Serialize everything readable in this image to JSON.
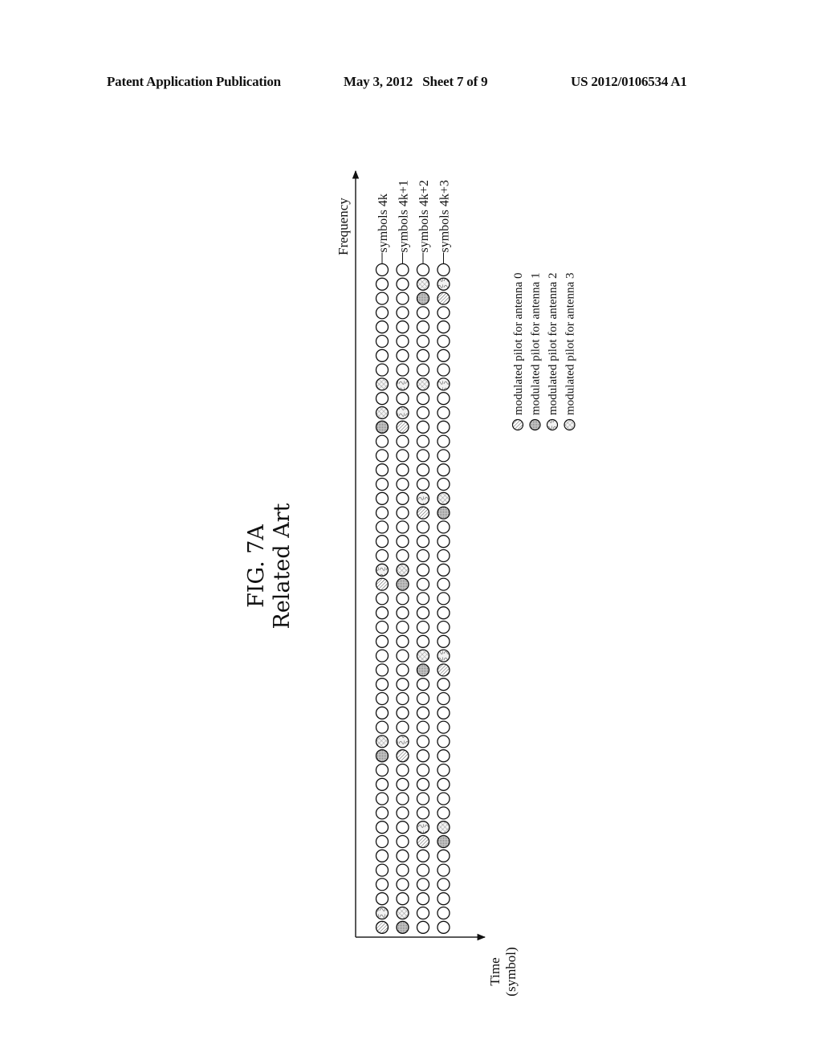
{
  "header": {
    "left": "Patent Application Publication",
    "middle": "May 3, 2012   Sheet 7 of 9",
    "right": "US 2012/0106534 A1"
  },
  "figure": {
    "title": "FIG. 7A",
    "subtitle": "Related Art"
  },
  "diagram": {
    "axis_frequency_label": "Frequency",
    "axis_time_label": "Time",
    "axis_time_sublabel": "(symbol)",
    "subcarriers_per_row": 47,
    "rows": [
      {
        "label": "symbols 4k",
        "pilots": [
          {
            "index": 8,
            "antenna": 3
          },
          {
            "index": 10,
            "antenna": 3
          },
          {
            "index": 11,
            "antenna": 1
          },
          {
            "index": 21,
            "antenna": 2
          },
          {
            "index": 22,
            "antenna": 0
          },
          {
            "index": 33,
            "antenna": 3
          },
          {
            "index": 34,
            "antenna": 1
          },
          {
            "index": 45,
            "antenna": 2
          },
          {
            "index": 46,
            "antenna": 0
          }
        ]
      },
      {
        "label": "symbols 4k+1",
        "pilots": [
          {
            "index": 8,
            "antenna": 2
          },
          {
            "index": 10,
            "antenna": 2
          },
          {
            "index": 11,
            "antenna": 0
          },
          {
            "index": 21,
            "antenna": 3
          },
          {
            "index": 22,
            "antenna": 1
          },
          {
            "index": 33,
            "antenna": 2
          },
          {
            "index": 34,
            "antenna": 0
          },
          {
            "index": 45,
            "antenna": 3
          },
          {
            "index": 46,
            "antenna": 1
          }
        ]
      },
      {
        "label": "symbols 4k+2",
        "pilots": [
          {
            "index": 1,
            "antenna": 3
          },
          {
            "index": 2,
            "antenna": 1
          },
          {
            "index": 8,
            "antenna": 3
          },
          {
            "index": 16,
            "antenna": 2
          },
          {
            "index": 17,
            "antenna": 0
          },
          {
            "index": 27,
            "antenna": 3
          },
          {
            "index": 28,
            "antenna": 1
          },
          {
            "index": 39,
            "antenna": 2
          },
          {
            "index": 40,
            "antenna": 0
          }
        ]
      },
      {
        "label": "symbols 4k+3",
        "pilots": [
          {
            "index": 1,
            "antenna": 2
          },
          {
            "index": 2,
            "antenna": 0
          },
          {
            "index": 8,
            "antenna": 2
          },
          {
            "index": 16,
            "antenna": 3
          },
          {
            "index": 17,
            "antenna": 1
          },
          {
            "index": 27,
            "antenna": 2
          },
          {
            "index": 28,
            "antenna": 0
          },
          {
            "index": 39,
            "antenna": 3
          },
          {
            "index": 40,
            "antenna": 1
          }
        ]
      }
    ],
    "legend": [
      {
        "antenna": 0,
        "pattern": "diagonal-hatch",
        "label": "modulated pilot for antenna 0"
      },
      {
        "antenna": 1,
        "pattern": "dense-dots",
        "label": "modulated pilot for antenna 1"
      },
      {
        "antenna": 2,
        "pattern": "squiggle",
        "label": "modulated pilot for antenna 2"
      },
      {
        "antenna": 3,
        "pattern": "crosshatch",
        "label": "modulated pilot for antenna 3"
      }
    ]
  }
}
